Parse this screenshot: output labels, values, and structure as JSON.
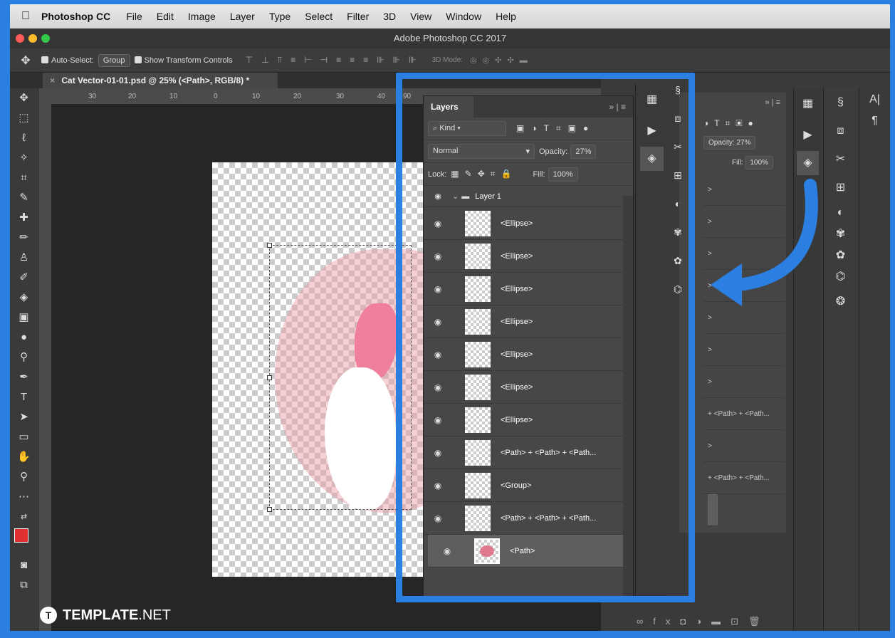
{
  "menubar": {
    "app": "Photoshop CC",
    "items": [
      "File",
      "Edit",
      "Image",
      "Layer",
      "Type",
      "Select",
      "Filter",
      "3D",
      "View",
      "Window",
      "Help"
    ]
  },
  "window": {
    "title": "Adobe Photoshop CC 2017"
  },
  "options": {
    "auto_select_label": "Auto-Select:",
    "auto_select_value": "Group",
    "show_transform": "Show Transform Controls",
    "mode_3d": "3D Mode:"
  },
  "document": {
    "tab": "Cat Vector-01-01.psd @ 25% (<Path>, RGB/8) *"
  },
  "ruler": {
    "ticks": [
      "30",
      "20",
      "10",
      "0",
      "10",
      "20",
      "30",
      "40",
      "90"
    ]
  },
  "layers_panel": {
    "title": "Layers",
    "filter_kind": "Kind",
    "blend_mode": "Normal",
    "opacity_label": "Opacity:",
    "opacity_value": "27%",
    "lock_label": "Lock:",
    "fill_label": "Fill:",
    "fill_value": "100%",
    "group_name": "Layer 1",
    "layers": [
      "<Ellipse>",
      "<Ellipse>",
      "<Ellipse>",
      "<Ellipse>",
      "<Ellipse>",
      "<Ellipse>",
      "<Ellipse>",
      "<Path> + <Path> + <Path...",
      "<Group>",
      "<Path> + <Path> + <Path...",
      "<Path>"
    ]
  },
  "ghost_panel": {
    "opacity_label": "Opacity:",
    "opacity_value": "27%",
    "fill_label": "Fill:",
    "fill_value": "100%",
    "rows": [
      ">",
      ">",
      ">",
      ">",
      ">",
      ">",
      ">",
      "+ <Path> + <Path...",
      ">",
      "+ <Path> + <Path...",
      ""
    ]
  },
  "watermark": {
    "brand": "TEMPLATE",
    "suffix": ".NET"
  },
  "colors": {
    "accent": "#2a7fe0",
    "foreground_swatch": "#e03030"
  }
}
